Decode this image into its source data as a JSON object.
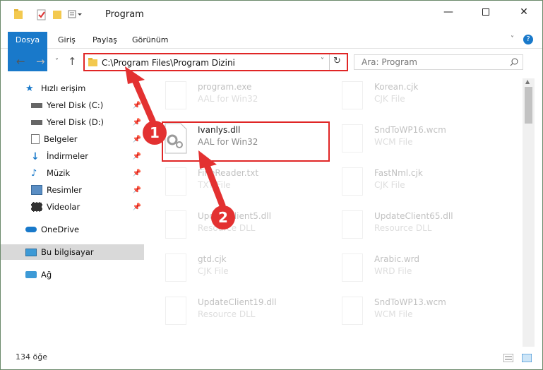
{
  "window": {
    "title": "Program"
  },
  "ribbon": {
    "tabs": [
      {
        "label": "Dosya"
      },
      {
        "label": "Giriş"
      },
      {
        "label": "Paylaş"
      },
      {
        "label": "Görünüm"
      }
    ]
  },
  "address": {
    "path": "C:\\Program Files\\Program Dizini",
    "search_placeholder": "Ara: Program"
  },
  "sidebar": {
    "items": [
      {
        "label": "Hızlı erişim",
        "icon": "star-icon"
      },
      {
        "label": "Yerel Disk (C:)",
        "icon": "drive-icon"
      },
      {
        "label": "Yerel Disk (D:)",
        "icon": "drive-icon"
      },
      {
        "label": "Belgeler",
        "icon": "document-icon"
      },
      {
        "label": "İndirmeler",
        "icon": "download-icon"
      },
      {
        "label": "Müzik",
        "icon": "music-icon"
      },
      {
        "label": "Resimler",
        "icon": "picture-icon"
      },
      {
        "label": "Videolar",
        "icon": "video-icon"
      },
      {
        "label": "OneDrive",
        "icon": "cloud-icon"
      },
      {
        "label": "Bu bilgisayar",
        "icon": "computer-icon"
      },
      {
        "label": "Ağ",
        "icon": "network-icon"
      }
    ]
  },
  "files": [
    {
      "name": "program.exe",
      "type": "AAL for Win32"
    },
    {
      "name": "Korean.cjk",
      "type": "CJK File"
    },
    {
      "name": "Ivanlys.dll",
      "type": "AAL for Win32"
    },
    {
      "name": "SndToWP16.wcm",
      "type": "WCM File"
    },
    {
      "name": "FineReader.txt",
      "type": "TXT File"
    },
    {
      "name": "FastNml.cjk",
      "type": "CJK File"
    },
    {
      "name": "UpdateClient5.dll",
      "type": "Resource DLL"
    },
    {
      "name": "UpdateClient65.dll",
      "type": "Resource DLL"
    },
    {
      "name": "gtd.cjk",
      "type": "CJK File"
    },
    {
      "name": "Arabic.wrd",
      "type": "WRD File"
    },
    {
      "name": "UpdateClient19.dll",
      "type": "Resource DLL"
    },
    {
      "name": "SndToWP13.wcm",
      "type": "WCM File"
    }
  ],
  "status": {
    "count": "134 öğe"
  },
  "markers": [
    "1",
    "2"
  ],
  "colors": {
    "accent": "#1979ca",
    "highlight": "#e02626"
  }
}
